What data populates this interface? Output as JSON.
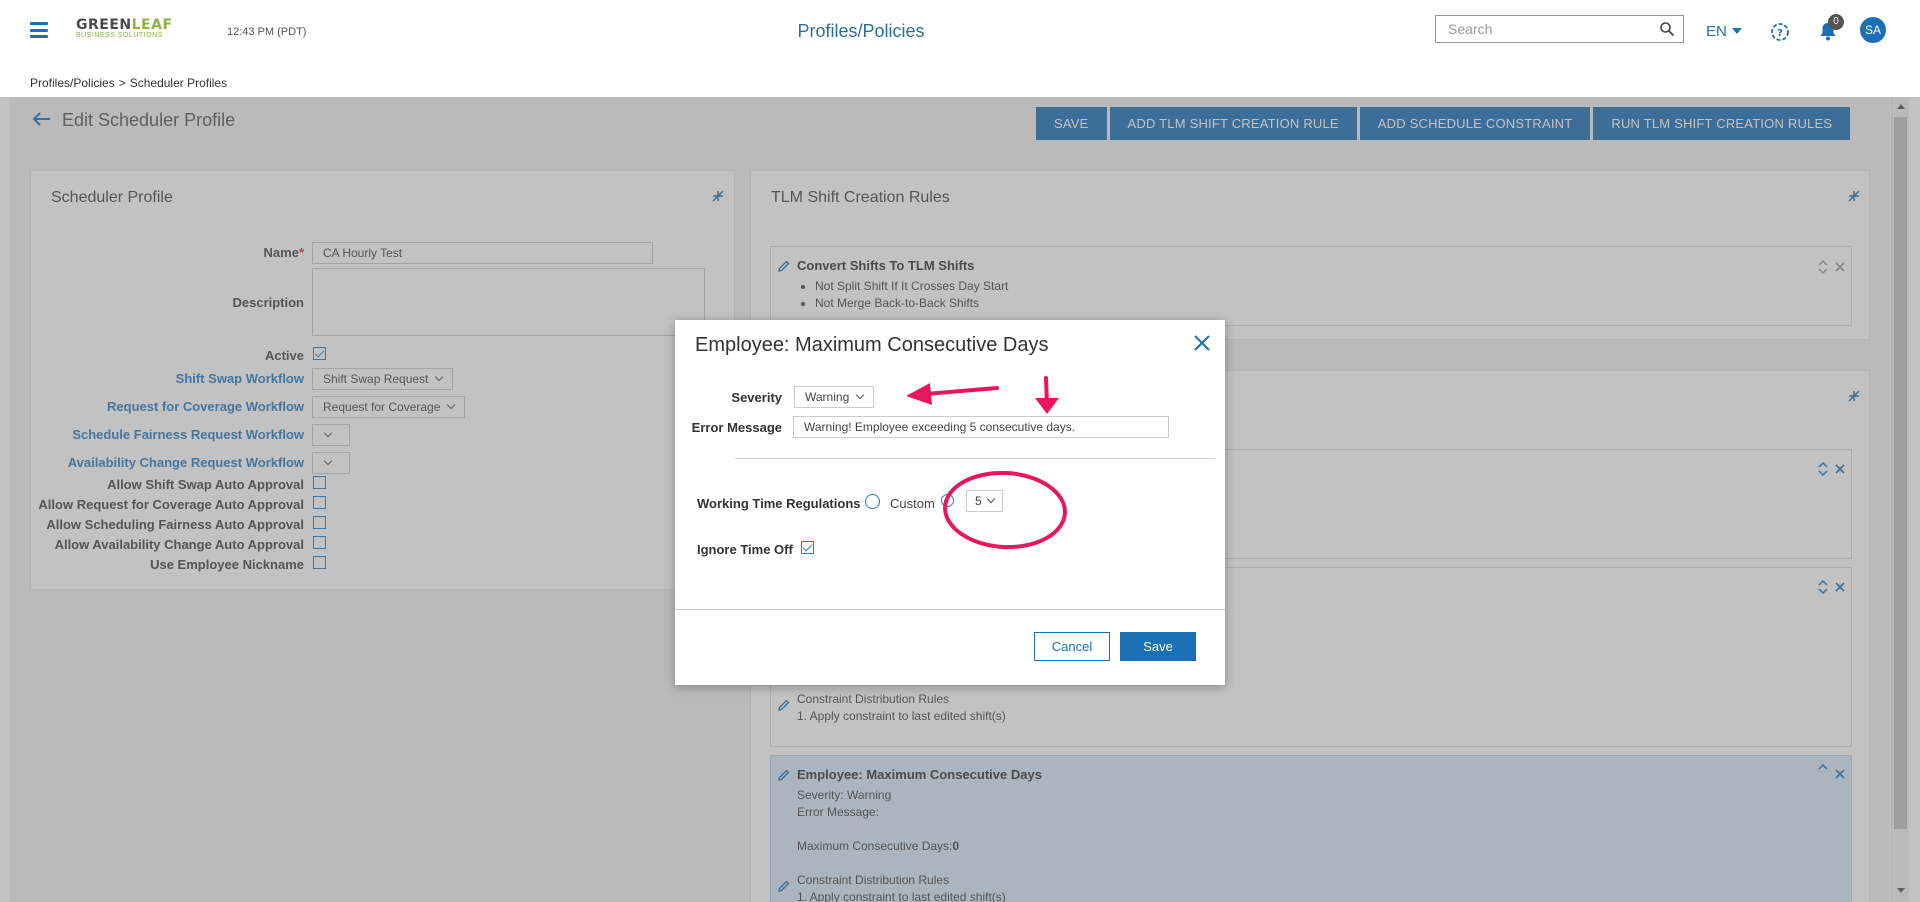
{
  "header": {
    "logo_line1_a": "GREEN",
    "logo_line1_b": "LEAF",
    "logo_line2": "BUSINESS SOLUTIONS",
    "clock": "12:43 PM (PDT)",
    "title": "Profiles/Policies",
    "search_placeholder": "Search",
    "language": "EN",
    "notification_count": "0",
    "avatar_initials": "SA"
  },
  "breadcrumb": {
    "item1": "Profiles/Policies",
    "separator": ">",
    "item2": "Scheduler Profiles"
  },
  "page": {
    "title": "Edit Scheduler Profile"
  },
  "toolbar": {
    "save": "SAVE",
    "add_tlm_rule": "ADD TLM SHIFT CREATION RULE",
    "add_constraint": "ADD SCHEDULE CONSTRAINT",
    "run_tlm_rules": "RUN TLM SHIFT CREATION RULES"
  },
  "profile": {
    "card_title": "Scheduler Profile",
    "name_label": "Name",
    "name_required": "*",
    "name_value": "CA Hourly Test",
    "description_label": "Description",
    "active_label": "Active",
    "shift_swap_label": "Shift Swap Workflow",
    "shift_swap_value": "Shift Swap Request",
    "coverage_label": "Request for Coverage Workflow",
    "coverage_value": "Request for Coverage",
    "fairness_label": "Schedule Fairness Request Workflow",
    "availability_label": "Availability Change Request Workflow",
    "auto_swap_label": "Allow Shift Swap Auto Approval",
    "auto_coverage_label": "Allow Request for Coverage Auto Approval",
    "auto_fairness_label": "Allow Scheduling Fairness Auto Approval",
    "auto_availability_label": "Allow Availability Change Auto Approval",
    "nickname_label": "Use Employee Nickname"
  },
  "rules_panel": {
    "card_title": "TLM Shift Creation Rules",
    "rule1": {
      "title": "Convert Shifts To TLM Shifts",
      "items": [
        "Not Split Shift If It Crosses Day Start",
        "Not Merge Back-to-Back Shifts"
      ]
    },
    "constraint_a": {
      "dist_title": "Constraint Distribution Rules",
      "dist_item": "1.  Apply constraint to last edited shift(s)"
    },
    "constraint_b": {
      "title": "Employee: Maximum Consecutive Days",
      "severity": "Severity: Warning",
      "error_message": "Error Message:",
      "max_days_label": "Maximum Consecutive Days:",
      "max_days_value": "0",
      "dist_title": "Constraint Distribution Rules",
      "dist_item": "1.  Apply constraint to last edited shift(s)"
    }
  },
  "modal": {
    "title": "Employee: Maximum Consecutive Days",
    "severity_label": "Severity",
    "severity_value": "Warning",
    "error_message_label": "Error Message",
    "error_message_value": "Warning! Employee exceeding 5 consecutive days.",
    "wtr_label": "Working Time Regulations",
    "custom_label": "Custom",
    "custom_value": "5",
    "ignore_time_off_label": "Ignore Time Off",
    "cancel": "Cancel",
    "save": "Save"
  },
  "colors": {
    "primary": "#1a6fb5",
    "link": "#2a7bc0",
    "brand_green": "#8ab33f",
    "annotation": "#e8175d",
    "highlight_row": "#d6e8f7"
  }
}
